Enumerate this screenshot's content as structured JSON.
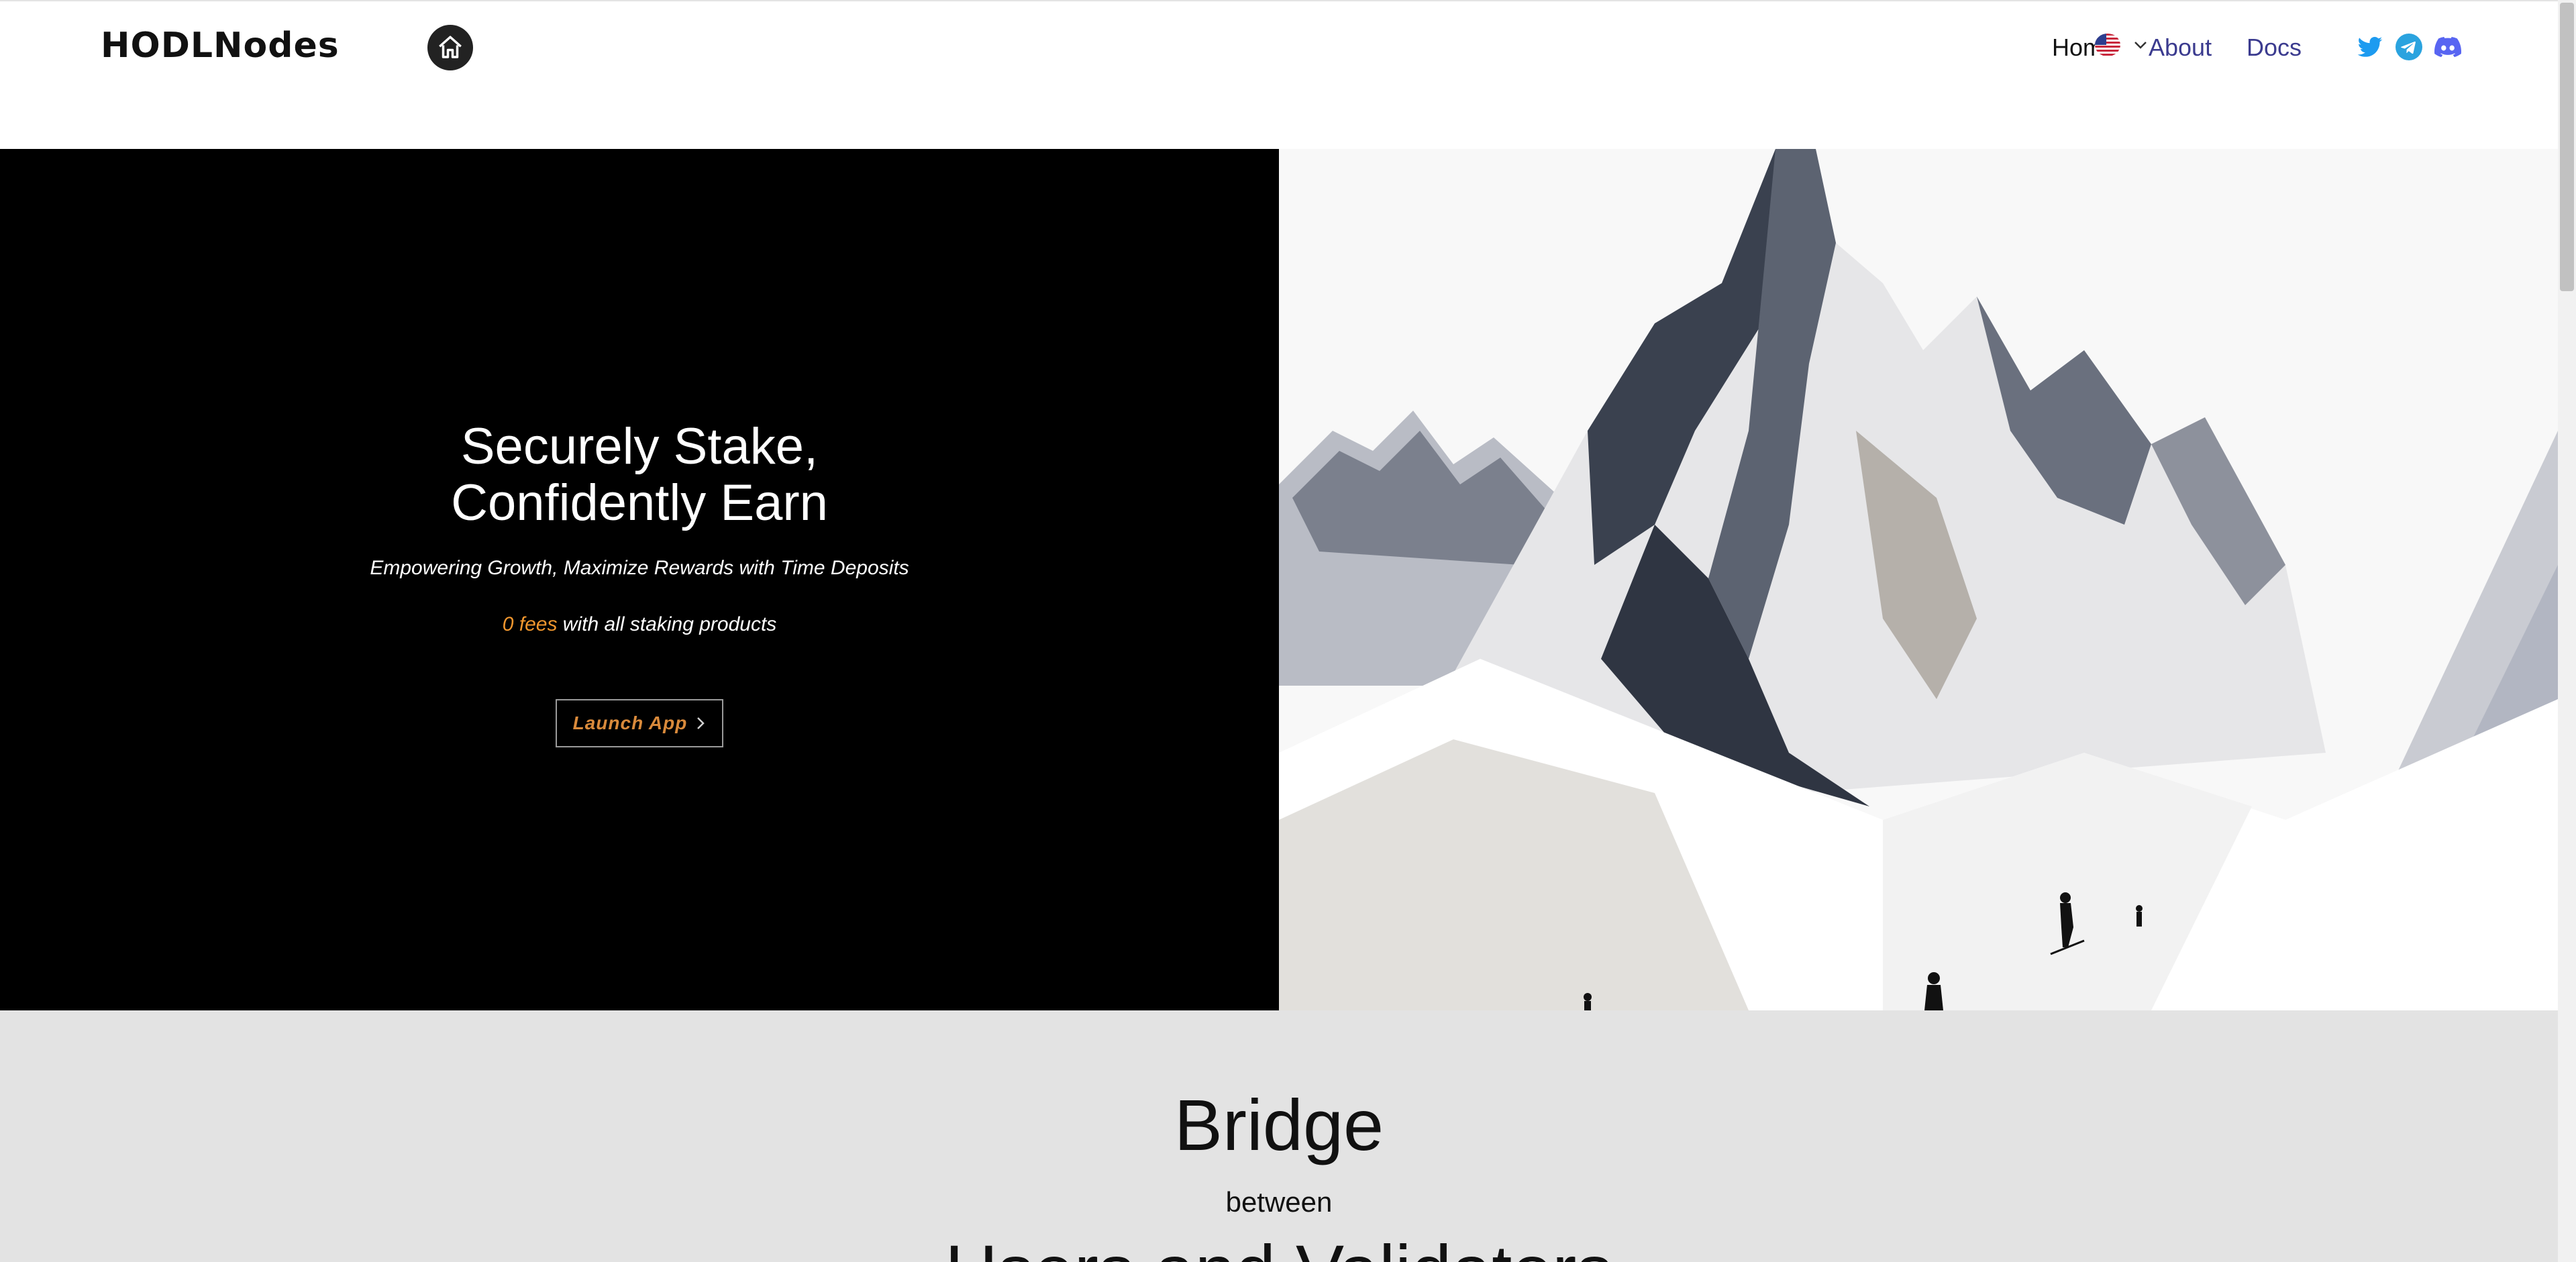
{
  "header": {
    "logo": "HODLNodes",
    "nav": {
      "home_label": "Home",
      "about_label": "About",
      "docs_label": "Docs"
    },
    "home_icon": "home-icon",
    "language_flag": "us-flag-icon",
    "social": [
      "twitter-icon",
      "telegram-icon",
      "discord-icon"
    ]
  },
  "hero": {
    "title_line1": "Securely Stake,",
    "title_line2": "Confidently Earn",
    "subtitle": "Empowering Growth, Maximize Rewards with Time Deposits",
    "fees_highlight": "0 fees",
    "fees_rest": " with all staking products",
    "launch_button": "Launch App",
    "image": "snowy-mountain-skiers-illustration"
  },
  "bridge": {
    "title": "Bridge",
    "between": "between",
    "subtitle": "Users and Validators"
  },
  "colors": {
    "accent": "#f0962e",
    "nav_link": "#3b3b8f",
    "hero_bg": "#000000",
    "section_bg": "#e3e3e3"
  }
}
